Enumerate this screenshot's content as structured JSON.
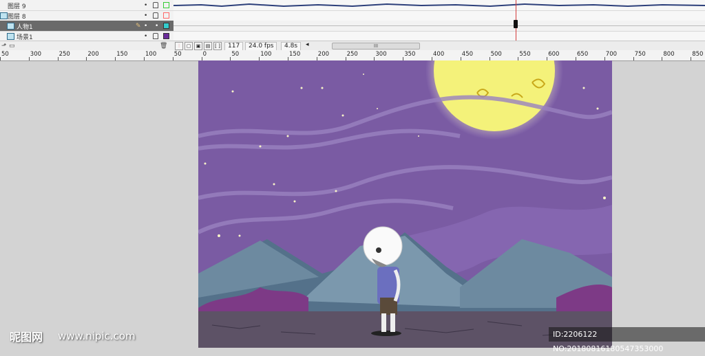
{
  "timeline": {
    "layers": [
      {
        "name": "图层 9",
        "type": "layer",
        "color": "#33cc33"
      },
      {
        "name": "图层 8",
        "type": "folder",
        "color": "#ff6666"
      },
      {
        "name": "人物1",
        "type": "child",
        "color": "#33cccc",
        "selected": true
      },
      {
        "name": "场景1",
        "type": "child",
        "color": "#6a2b9a"
      }
    ],
    "current_frame": "117",
    "frame_rate": "24.0 fps",
    "elapsed_time": "4.8s",
    "scrollbar_grip": "III"
  },
  "ruler": {
    "labels": [
      "50",
      "300",
      "250",
      "200",
      "150",
      "100",
      "50",
      "0",
      "50",
      "100",
      "150",
      "200",
      "250",
      "300",
      "350",
      "400",
      "450",
      "500",
      "550",
      "600",
      "650",
      "700",
      "750",
      "800",
      "850"
    ]
  },
  "watermark": {
    "logo_text": "昵图网",
    "url": "www.nipic.com",
    "id_text": "ID:2206122 NO:20180816180547353000"
  },
  "scene": {
    "sky_color": "#7a5ba3",
    "moon_color": "#f4f27a",
    "mountain_color": "#6d8aa0",
    "ground_color": "#5d5266"
  }
}
